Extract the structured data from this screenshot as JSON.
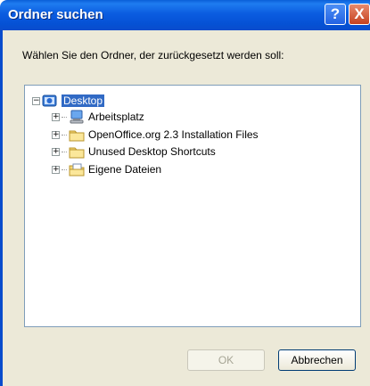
{
  "window": {
    "title": "Ordner suchen",
    "help_label": "?",
    "close_label": "X"
  },
  "prompt": "Wählen Sie den Ordner, der zurückgesetzt werden soll:",
  "tree": {
    "root": {
      "label": "Desktop",
      "expander": "−",
      "icon": "desktop-icon"
    },
    "children": [
      {
        "label": "Arbeitsplatz",
        "expander": "+",
        "icon": "computer-icon"
      },
      {
        "label": "OpenOffice.org 2.3 Installation Files",
        "expander": "+",
        "icon": "folder-icon"
      },
      {
        "label": "Unused Desktop Shortcuts",
        "expander": "+",
        "icon": "folder-icon"
      },
      {
        "label": "Eigene Dateien",
        "expander": "+",
        "icon": "documents-icon"
      }
    ]
  },
  "buttons": {
    "ok": "OK",
    "cancel": "Abbrechen"
  }
}
